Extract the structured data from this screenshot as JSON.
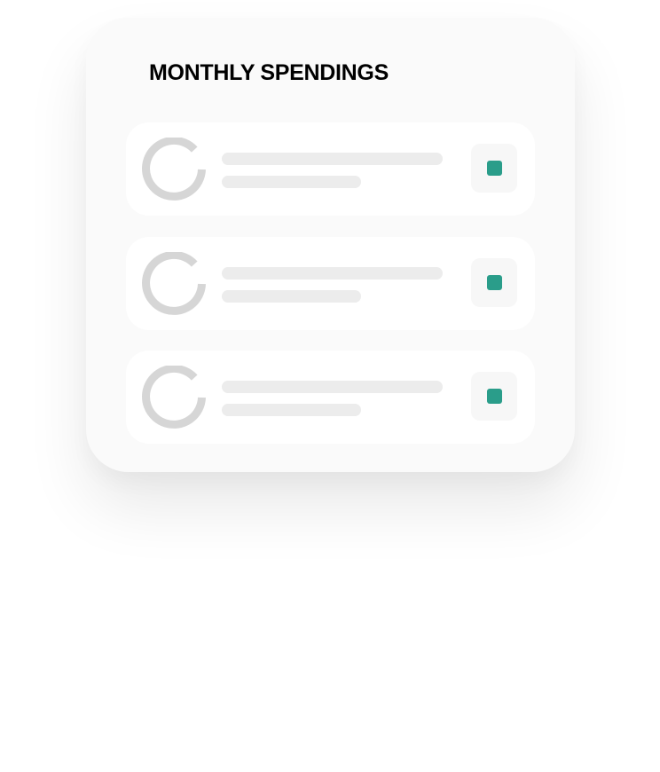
{
  "card": {
    "title": "MONTHLY SPENDINGS"
  },
  "colors": {
    "accent": "#2a9d8a",
    "ring": "#d6d6d6",
    "placeholder_line": "#ececec",
    "card_background": "#fafafa",
    "item_background": "#ffffff"
  },
  "items": [
    {
      "icon": "progress-ring-icon",
      "action_icon": "square-dot-icon"
    },
    {
      "icon": "progress-ring-icon",
      "action_icon": "square-dot-icon"
    },
    {
      "icon": "progress-ring-icon",
      "action_icon": "square-dot-icon"
    }
  ]
}
